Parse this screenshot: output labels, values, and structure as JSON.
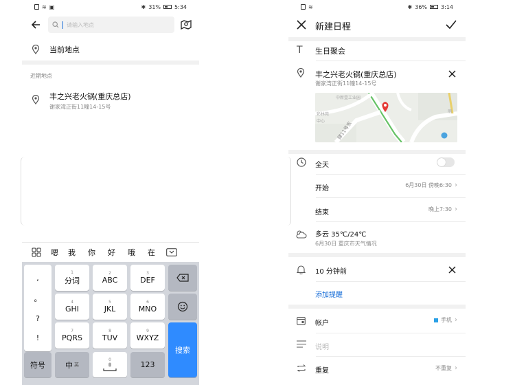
{
  "left": {
    "status": {
      "battery": "31%",
      "time": "5:34"
    },
    "search": {
      "placeholder": "请输入地点"
    },
    "current_location": "当前地点",
    "recent_header": "近期地点",
    "recent": [
      {
        "name": "丰之兴老火锅(重庆总店)",
        "address": "谢家湾正街11幢14-15号"
      }
    ],
    "candidates": [
      "嗯",
      "我",
      "你",
      "好",
      "哦",
      "在"
    ],
    "keyboard": {
      "punct": [
        ",",
        "。",
        "?",
        "!"
      ],
      "row1": [
        {
          "num": "1",
          "label": "分词"
        },
        {
          "num": "2",
          "label": "ABC"
        },
        {
          "num": "3",
          "label": "DEF"
        }
      ],
      "row2": [
        {
          "num": "4",
          "label": "GHI"
        },
        {
          "num": "5",
          "label": "JKL"
        },
        {
          "num": "6",
          "label": "MNO"
        }
      ],
      "row3": [
        {
          "num": "7",
          "label": "PQRS"
        },
        {
          "num": "8",
          "label": "TUV"
        },
        {
          "num": "9",
          "label": "WXYZ"
        }
      ],
      "symbol": "符号",
      "lang": "中",
      "lang_sub": "英",
      "space_num": "0",
      "numbers": "123",
      "search": "搜索"
    }
  },
  "right": {
    "status": {
      "battery": "36%",
      "time": "3:14"
    },
    "title": "新建日程",
    "event_title": "生日聚会",
    "location": {
      "name": "丰之兴老火锅(重庆总店)",
      "address": "谢家湾正街11幢14-15号"
    },
    "map": {
      "road_label": "肆11号东",
      "poi_label_1": "中新壹工业园",
      "poi_label_2": "彩林苑",
      "poi_label_3": "中心",
      "poi_label_4": "丽"
    },
    "all_day": {
      "label": "全天",
      "on": false
    },
    "start": {
      "label": "开始",
      "value": "6月30日 傍晚6:30"
    },
    "end": {
      "label": "结束",
      "value": "晚上7:30"
    },
    "weather": {
      "title": "多云 35℃/24℃",
      "sub": "6月30日 重庆市天气情况"
    },
    "reminder": {
      "label": "10 分钟前",
      "add": "添加提醒"
    },
    "account": {
      "label": "帐户",
      "value": "手机"
    },
    "description": {
      "placeholder": "说明"
    },
    "repeat": {
      "label": "重复",
      "value": "不重复"
    }
  },
  "colors": {
    "accent": "#1a6fd8",
    "keyboard_blue": "#2f8bff",
    "account_dot": "#2aa0e6"
  }
}
